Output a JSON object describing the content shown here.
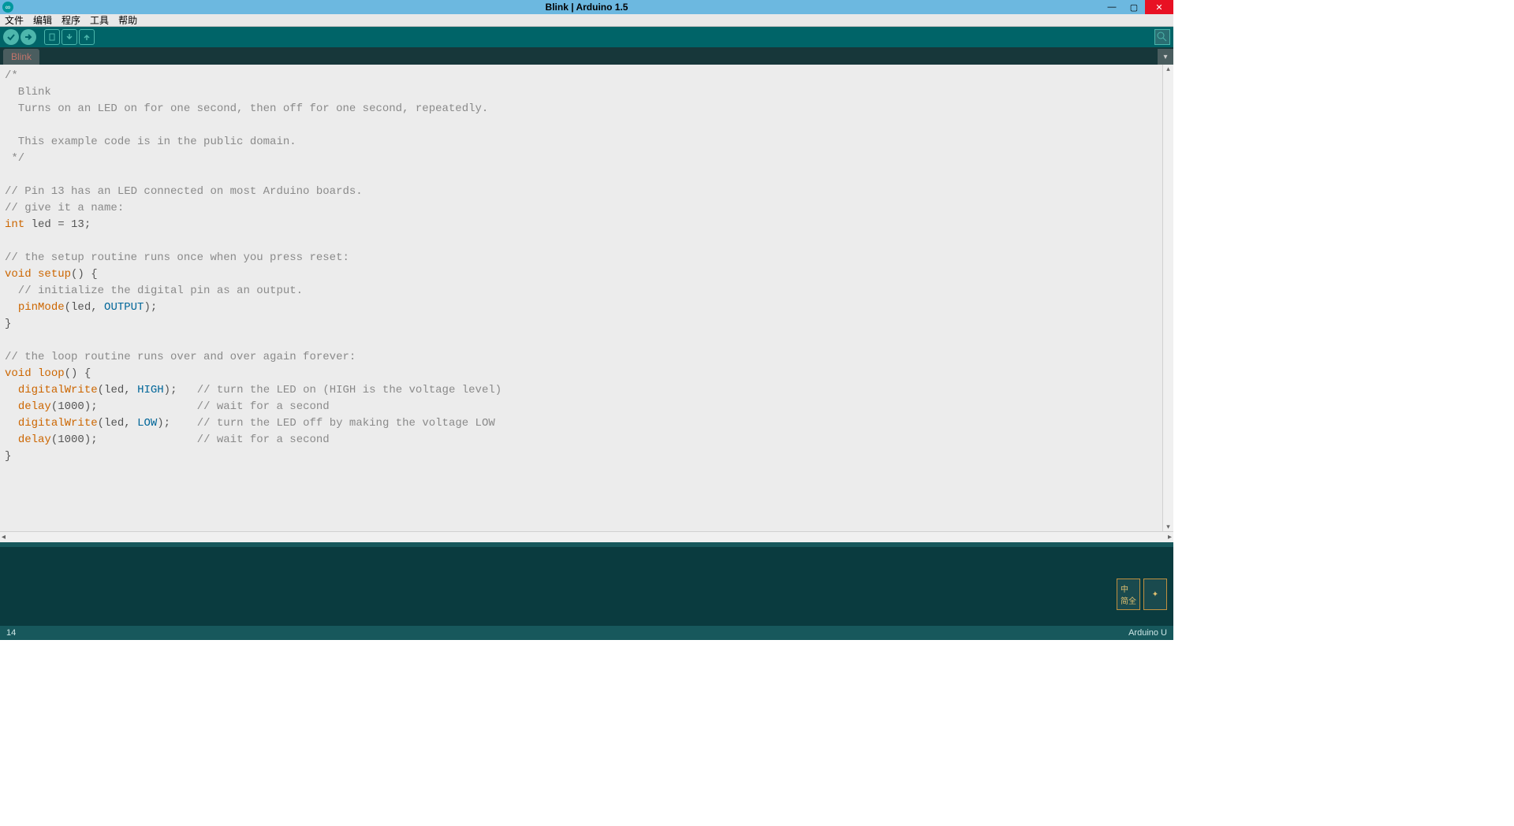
{
  "window": {
    "title": "Blink | Arduino 1.5"
  },
  "menubar": [
    "文件",
    "编辑",
    "程序",
    "工具",
    "帮助"
  ],
  "tab": {
    "name": "Blink"
  },
  "code_lines": [
    {
      "t": "cm",
      "text": "/*"
    },
    {
      "t": "cm",
      "text": "  Blink"
    },
    {
      "t": "cm",
      "text": "  Turns on an LED on for one second, then off for one second, repeatedly."
    },
    {
      "t": "cm",
      "text": " "
    },
    {
      "t": "cm",
      "text": "  This example code is in the public domain."
    },
    {
      "t": "cm",
      "text": " */"
    },
    {
      "t": "",
      "text": ""
    },
    {
      "t": "cm",
      "text": "// Pin 13 has an LED connected on most Arduino boards."
    },
    {
      "t": "cm",
      "text": "// give it a name:"
    },
    {
      "t": "mix",
      "segs": [
        {
          "c": "kw",
          "s": "int"
        },
        {
          "c": "",
          "s": " led = 13;"
        }
      ]
    },
    {
      "t": "",
      "text": ""
    },
    {
      "t": "cm",
      "text": "// the setup routine runs once when you press reset:"
    },
    {
      "t": "mix",
      "segs": [
        {
          "c": "kw",
          "s": "void"
        },
        {
          "c": "",
          "s": " "
        },
        {
          "c": "fn",
          "s": "setup"
        },
        {
          "c": "",
          "s": "() {"
        }
      ]
    },
    {
      "t": "cm",
      "text": "  // initialize the digital pin as an output."
    },
    {
      "t": "mix",
      "segs": [
        {
          "c": "",
          "s": "  "
        },
        {
          "c": "fn",
          "s": "pinMode"
        },
        {
          "c": "",
          "s": "(led, "
        },
        {
          "c": "const",
          "s": "OUTPUT"
        },
        {
          "c": "",
          "s": ");"
        }
      ]
    },
    {
      "t": "",
      "text": "}"
    },
    {
      "t": "",
      "text": ""
    },
    {
      "t": "cm",
      "text": "// the loop routine runs over and over again forever:"
    },
    {
      "t": "mix",
      "segs": [
        {
          "c": "kw",
          "s": "void"
        },
        {
          "c": "",
          "s": " "
        },
        {
          "c": "fn",
          "s": "loop"
        },
        {
          "c": "",
          "s": "() {"
        }
      ]
    },
    {
      "t": "mix",
      "segs": [
        {
          "c": "",
          "s": "  "
        },
        {
          "c": "fn",
          "s": "digitalWrite"
        },
        {
          "c": "",
          "s": "(led, "
        },
        {
          "c": "const",
          "s": "HIGH"
        },
        {
          "c": "",
          "s": ");   "
        },
        {
          "c": "cm",
          "s": "// turn the LED on (HIGH is the voltage level)"
        }
      ]
    },
    {
      "t": "mix",
      "segs": [
        {
          "c": "",
          "s": "  "
        },
        {
          "c": "fn",
          "s": "delay"
        },
        {
          "c": "",
          "s": "(1000);               "
        },
        {
          "c": "cm",
          "s": "// wait for a second"
        }
      ]
    },
    {
      "t": "mix",
      "segs": [
        {
          "c": "",
          "s": "  "
        },
        {
          "c": "fn",
          "s": "digitalWrite"
        },
        {
          "c": "",
          "s": "(led, "
        },
        {
          "c": "const",
          "s": "LOW"
        },
        {
          "c": "",
          "s": ");    "
        },
        {
          "c": "cm",
          "s": "// turn the LED off by making the voltage LOW"
        }
      ]
    },
    {
      "t": "mix",
      "segs": [
        {
          "c": "",
          "s": "  "
        },
        {
          "c": "fn",
          "s": "delay"
        },
        {
          "c": "",
          "s": "(1000);               "
        },
        {
          "c": "cm",
          "s": "// wait for a second"
        }
      ]
    },
    {
      "t": "",
      "text": "}"
    }
  ],
  "status": {
    "line_number": "14",
    "board": "Arduino U"
  }
}
